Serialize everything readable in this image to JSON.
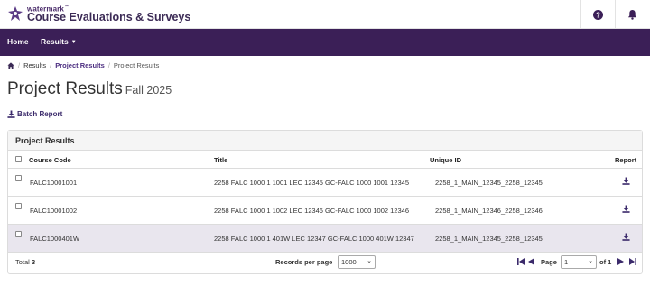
{
  "header": {
    "brand_small": "watermark",
    "brand_tm": "™",
    "brand_name": "Course Evaluations & Surveys"
  },
  "nav": {
    "home": "Home",
    "results": "Results"
  },
  "breadcrumb": {
    "items": [
      "Results",
      "Project Results",
      "Project Results"
    ]
  },
  "page": {
    "title": "Project Results",
    "term": "Fall 2025",
    "batch_report": "Batch Report"
  },
  "panel": {
    "heading": "Project Results",
    "columns": {
      "course_code": "Course Code",
      "title": "Title",
      "unique_id": "Unique ID",
      "report": "Report"
    },
    "rows": [
      {
        "course_code": "FALC10001001",
        "title": "2258 FALC 1000 1 1001 LEC 12345 GC-FALC 1000 1001 12345",
        "unique_id": "2258_1_MAIN_12345_2258_12345"
      },
      {
        "course_code": "FALC10001002",
        "title": "2258 FALC 1000 1 1002 LEC 12346 GC-FALC 1000 1002 12346",
        "unique_id": "2258_1_MAIN_12346_2258_12346"
      },
      {
        "course_code": "FALC1000401W",
        "title": "2258 FALC 1000 1 401W LEC 12347 GC-FALC 1000 401W 12347",
        "unique_id": "2258_1_MAIN_12345_2258_12345"
      }
    ],
    "footer": {
      "total_label": "Total",
      "total_value": "3",
      "records_label": "Records per page",
      "records_value": "1000",
      "page_label": "Page",
      "page_value": "1",
      "of_label": "of 1"
    }
  },
  "colors": {
    "nav_bg": "#3b1f57",
    "brand": "#3b2a55",
    "link": "#4b2d80",
    "alt_row": "#e9e6ee"
  }
}
